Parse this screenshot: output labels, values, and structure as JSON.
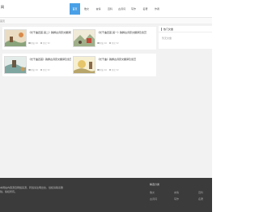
{
  "header": {
    "logo": "网",
    "nav": [
      "首页",
      "散文",
      "言情",
      "百科",
      "古诗词",
      "写作",
      "名著",
      "作者"
    ],
    "active_index": 0
  },
  "breadcrumb": "首页",
  "articles": [
    {
      "title": "《长干曲四首·其二》韵脚古诗原文翻译及鉴赏",
      "views": "浏览 46",
      "comments": "评论 52",
      "thumb_color": "#c9a875"
    },
    {
      "title": "《长干曲四首·其一》韵脚古诗原文翻译及鉴赏",
      "views": "浏览 46",
      "comments": "评论 52",
      "thumb_color": "#b9c9a8"
    },
    {
      "title": "《长干曲四首》韵脚古诗原文翻译及鉴赏",
      "views": "浏览 46",
      "comments": "评论 52",
      "thumb_color": "#a8c4c2"
    },
    {
      "title": "《长干曲》韵脚古诗原文翻译及鉴赏",
      "views": "浏览 46",
      "comments": "评论 52",
      "thumb_color": "#d8c98b"
    }
  ],
  "sidebar": {
    "title": "热门文章",
    "text": "暂无文章"
  },
  "footer": {
    "about": "本网站内容源自网络来源，转载请注明出处，侵权请联系删除。版权所有。",
    "links_title": "精选分类",
    "links": [
      "散文",
      "言情",
      "百科",
      "古诗词",
      "写作",
      "名著"
    ]
  },
  "colors": {
    "accent": "#4aa0e6",
    "footer_bg": "#3b3b3b",
    "content_bg": "#f2f2f2"
  }
}
